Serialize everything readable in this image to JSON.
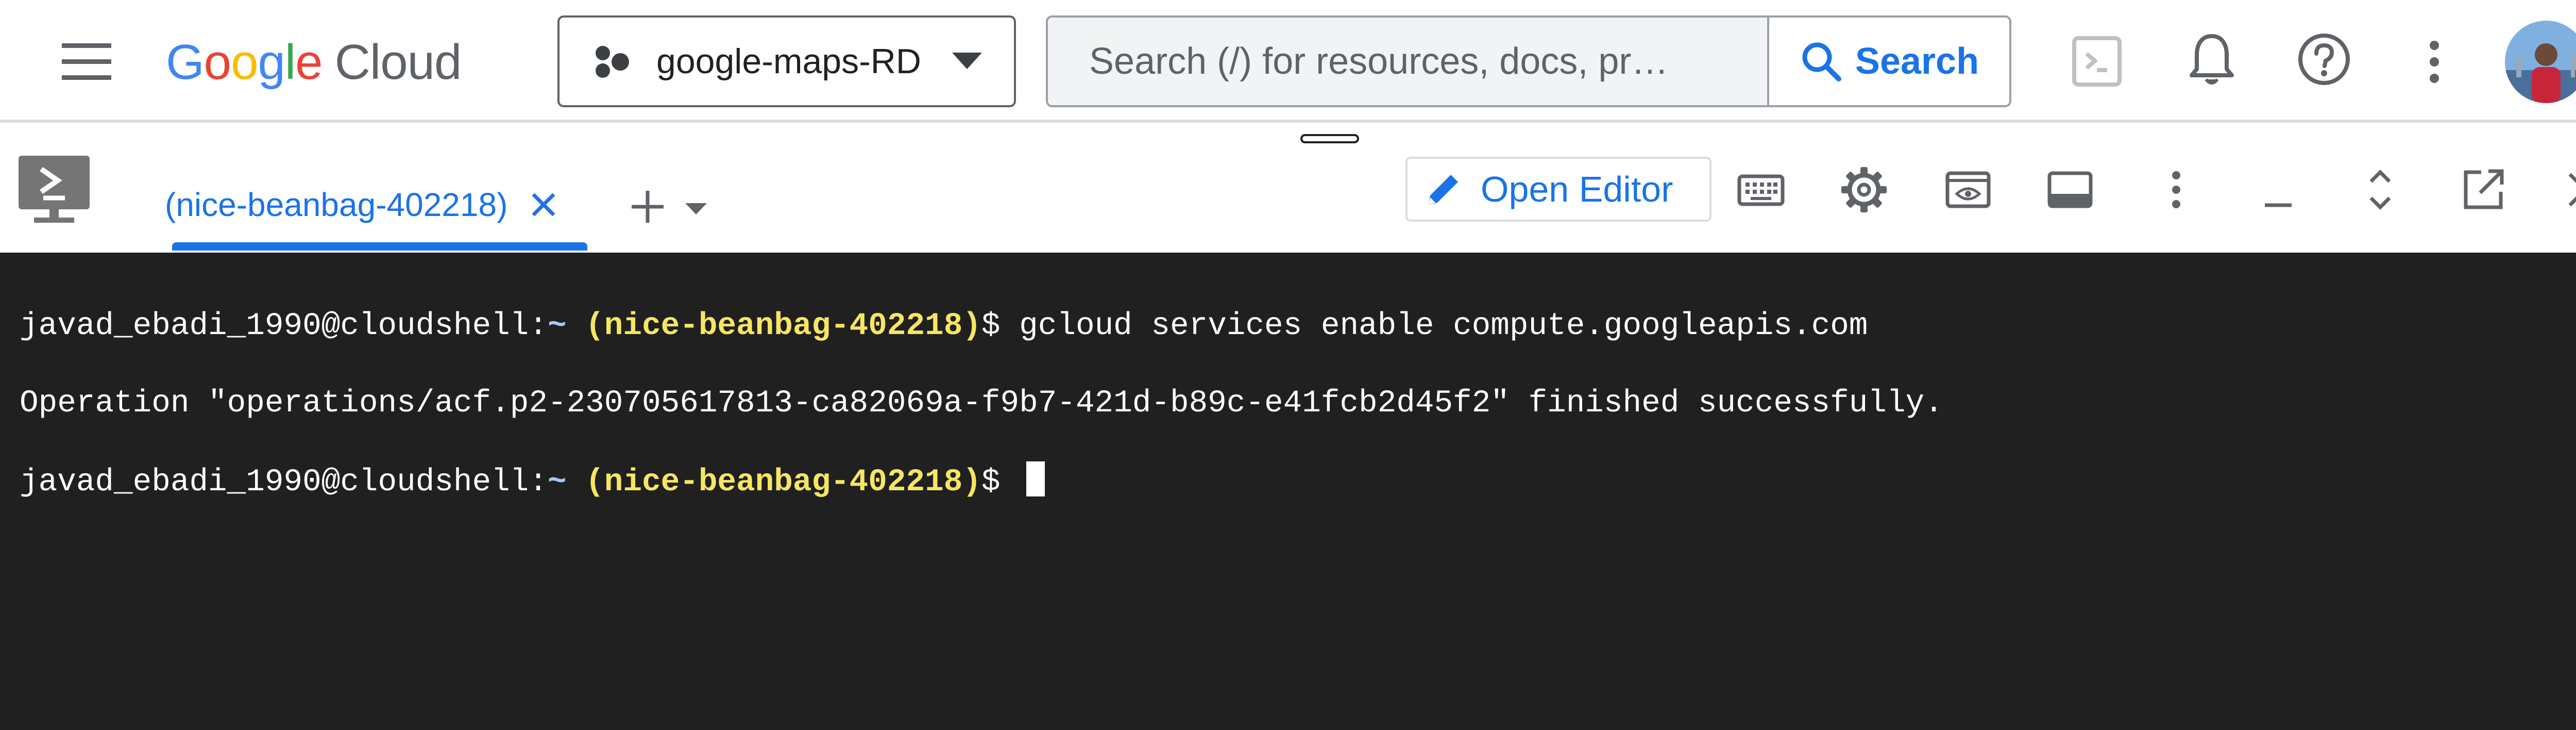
{
  "header": {
    "logo_google": [
      "G",
      "o",
      "o",
      "g",
      "l",
      "e"
    ],
    "logo_cloud": "Cloud",
    "project_name": "google-maps-RD",
    "search_placeholder": "Search (/) for resources, docs, pr…",
    "search_button": "Search"
  },
  "shell": {
    "active_tab": "(nice-beanbag-402218)",
    "open_editor_label": "Open Editor"
  },
  "terminal": {
    "lines": [
      {
        "user": "javad_ebadi_1990@cloudshell:",
        "path": "~",
        "project": "(nice-beanbag-402218)",
        "prompt": "$ ",
        "command": "gcloud services enable compute.googleapis.com"
      },
      {
        "output": "Operation \"operations/acf.p2-230705617813-ca82069a-f9b7-421d-b89c-e41fcb2d45f2\" finished successfully."
      },
      {
        "user": "javad_ebadi_1990@cloudshell:",
        "path": "~",
        "project": "(nice-beanbag-402218)",
        "prompt": "$ ",
        "command": ""
      }
    ]
  },
  "icons": {
    "header": [
      "menu-icon",
      "project-icon",
      "search-icon",
      "cloud-shell-icon",
      "bell-icon",
      "help-icon",
      "more-vert-icon"
    ],
    "toolbar": [
      "pencil-icon",
      "keyboard-icon",
      "settings-icon",
      "web-preview-icon",
      "layout-icon",
      "more-vert-icon",
      "minimize-icon",
      "restore-icon",
      "new-window-icon",
      "close-icon"
    ]
  },
  "colors": {
    "accent": "#1a73e8",
    "terminal_bg": "#202020",
    "prompt_project": "#f5e663",
    "prompt_path": "#a8c7fa"
  }
}
